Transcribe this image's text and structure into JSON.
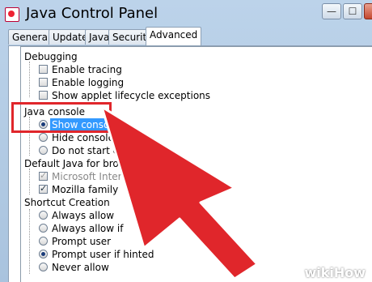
{
  "window": {
    "title": "Java Control Panel",
    "min": "—",
    "max": "☐",
    "close": "✕"
  },
  "tabs": [
    "General",
    "Update",
    "Java",
    "Security",
    "Advanced"
  ],
  "tree": {
    "debugging": {
      "heading": "Debugging",
      "items": [
        {
          "label": "Enable tracing",
          "checked": false
        },
        {
          "label": "Enable logging",
          "checked": false
        },
        {
          "label": "Show applet lifecycle exceptions",
          "checked": false
        }
      ]
    },
    "java_console": {
      "heading": "Java console",
      "items": [
        {
          "label": "Show console",
          "selected": true
        },
        {
          "label": "Hide console",
          "selected": false
        },
        {
          "label": "Do not start co",
          "selected": false
        }
      ]
    },
    "default_java": {
      "heading": "Default Java for brow",
      "items": [
        {
          "label": "Microsoft Intern",
          "checked": true,
          "disabled": true
        },
        {
          "label": "Mozilla family",
          "checked": true,
          "disabled": false
        }
      ]
    },
    "shortcut": {
      "heading": "Shortcut Creation",
      "items": [
        {
          "label": "Always allow",
          "selected": false
        },
        {
          "label": "Always allow if",
          "selected": false
        },
        {
          "label": "Prompt user",
          "selected": false
        },
        {
          "label": "Prompt user if hinted",
          "selected": true
        },
        {
          "label": "Never allow",
          "selected": false
        }
      ]
    }
  },
  "watermark": {
    "wiki": "wiki",
    "how": "How"
  },
  "colors": {
    "arrow": "#e0262b",
    "highlight": "#3399ff"
  }
}
